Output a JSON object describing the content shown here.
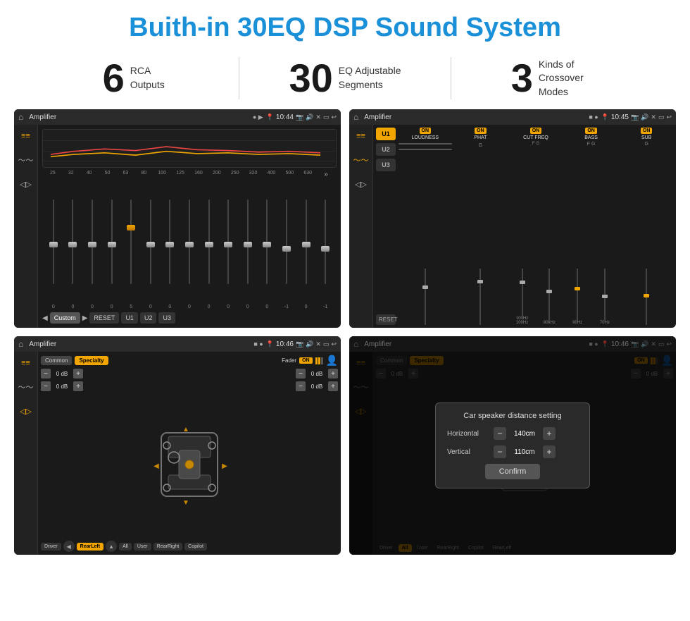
{
  "page": {
    "title": "Buith-in 30EQ DSP Sound System"
  },
  "stats": [
    {
      "number": "6",
      "text": "RCA\nOutputs"
    },
    {
      "number": "30",
      "text": "EQ Adjustable\nSegments"
    },
    {
      "number": "3",
      "text": "Kinds of\nCrossover Modes"
    }
  ],
  "screens": [
    {
      "id": "screen1",
      "title": "Amplifier",
      "time": "10:44",
      "type": "eq"
    },
    {
      "id": "screen2",
      "title": "Amplifier",
      "time": "10:45",
      "type": "crossover"
    },
    {
      "id": "screen3",
      "title": "Amplifier",
      "time": "10:46",
      "type": "speaker"
    },
    {
      "id": "screen4",
      "title": "Amplifier",
      "time": "10:46",
      "type": "distance"
    }
  ],
  "eq": {
    "freqs": [
      "25",
      "32",
      "40",
      "50",
      "63",
      "80",
      "100",
      "125",
      "160",
      "200",
      "250",
      "320",
      "400",
      "500",
      "630"
    ],
    "values": [
      "0",
      "0",
      "0",
      "0",
      "5",
      "0",
      "0",
      "0",
      "0",
      "0",
      "0",
      "0",
      "-1",
      "0",
      "-1"
    ],
    "preset": "Custom",
    "buttons": [
      "RESET",
      "U1",
      "U2",
      "U3"
    ]
  },
  "crossover": {
    "uButtons": [
      "U1",
      "U2",
      "U3"
    ],
    "activeU": "U1",
    "modules": [
      {
        "label": "LOUDNESS",
        "on": true
      },
      {
        "label": "PHAT",
        "on": true
      },
      {
        "label": "CUT FREQ",
        "on": true
      },
      {
        "label": "BASS",
        "on": true
      },
      {
        "label": "SUB",
        "on": true
      }
    ]
  },
  "speaker": {
    "tabs": [
      "Common",
      "Specialty"
    ],
    "activeTab": "Specialty",
    "fader": "Fader",
    "faderOn": true,
    "dbValues": [
      "0 dB",
      "0 dB",
      "0 dB",
      "0 dB"
    ],
    "positions": [
      "Driver",
      "RearLeft",
      "All",
      "User",
      "RearRight",
      "Copilot"
    ],
    "activePosition": "All"
  },
  "dialog": {
    "title": "Car speaker distance setting",
    "horizontal": {
      "label": "Horizontal",
      "value": "140cm"
    },
    "vertical": {
      "label": "Vertical",
      "value": "110cm"
    },
    "confirm": "Confirm"
  }
}
